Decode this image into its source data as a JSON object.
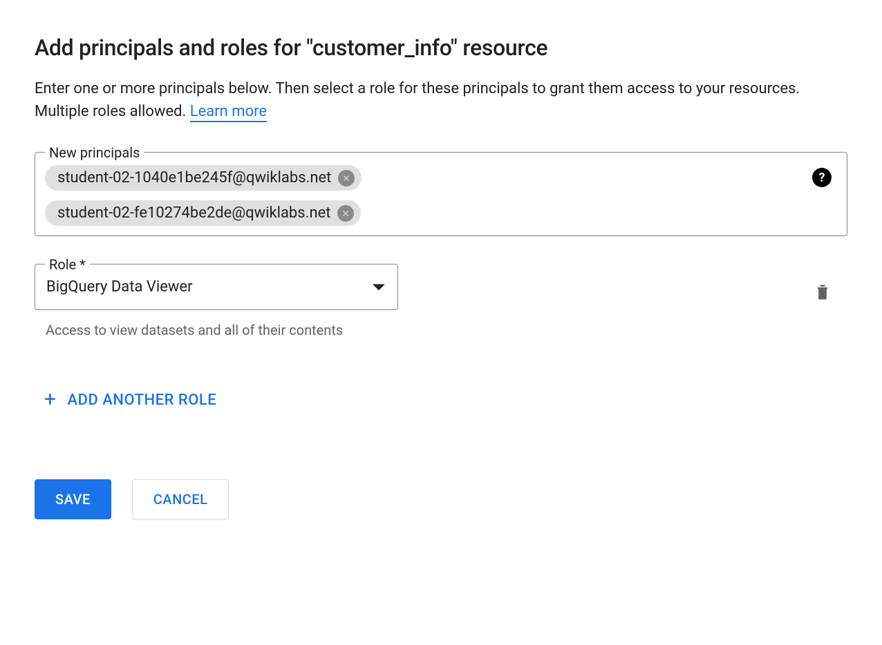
{
  "page_title": "Add principals and roles for \"customer_info\" resource",
  "description_text": "Enter one or more principals below. Then select a role for these principals to grant them access to your resources. Multiple roles allowed. ",
  "learn_more_label": "Learn more",
  "principals_field": {
    "label": "New principals",
    "chips": [
      "student-02-1040e1be245f@qwiklabs.net",
      "student-02-fe10274be2de@qwiklabs.net"
    ]
  },
  "role_field": {
    "label": "Role *",
    "selected": "BigQuery Data Viewer",
    "description": "Access to view datasets and all of their contents"
  },
  "add_role_label": "ADD ANOTHER ROLE",
  "buttons": {
    "save": "SAVE",
    "cancel": "CANCEL"
  }
}
